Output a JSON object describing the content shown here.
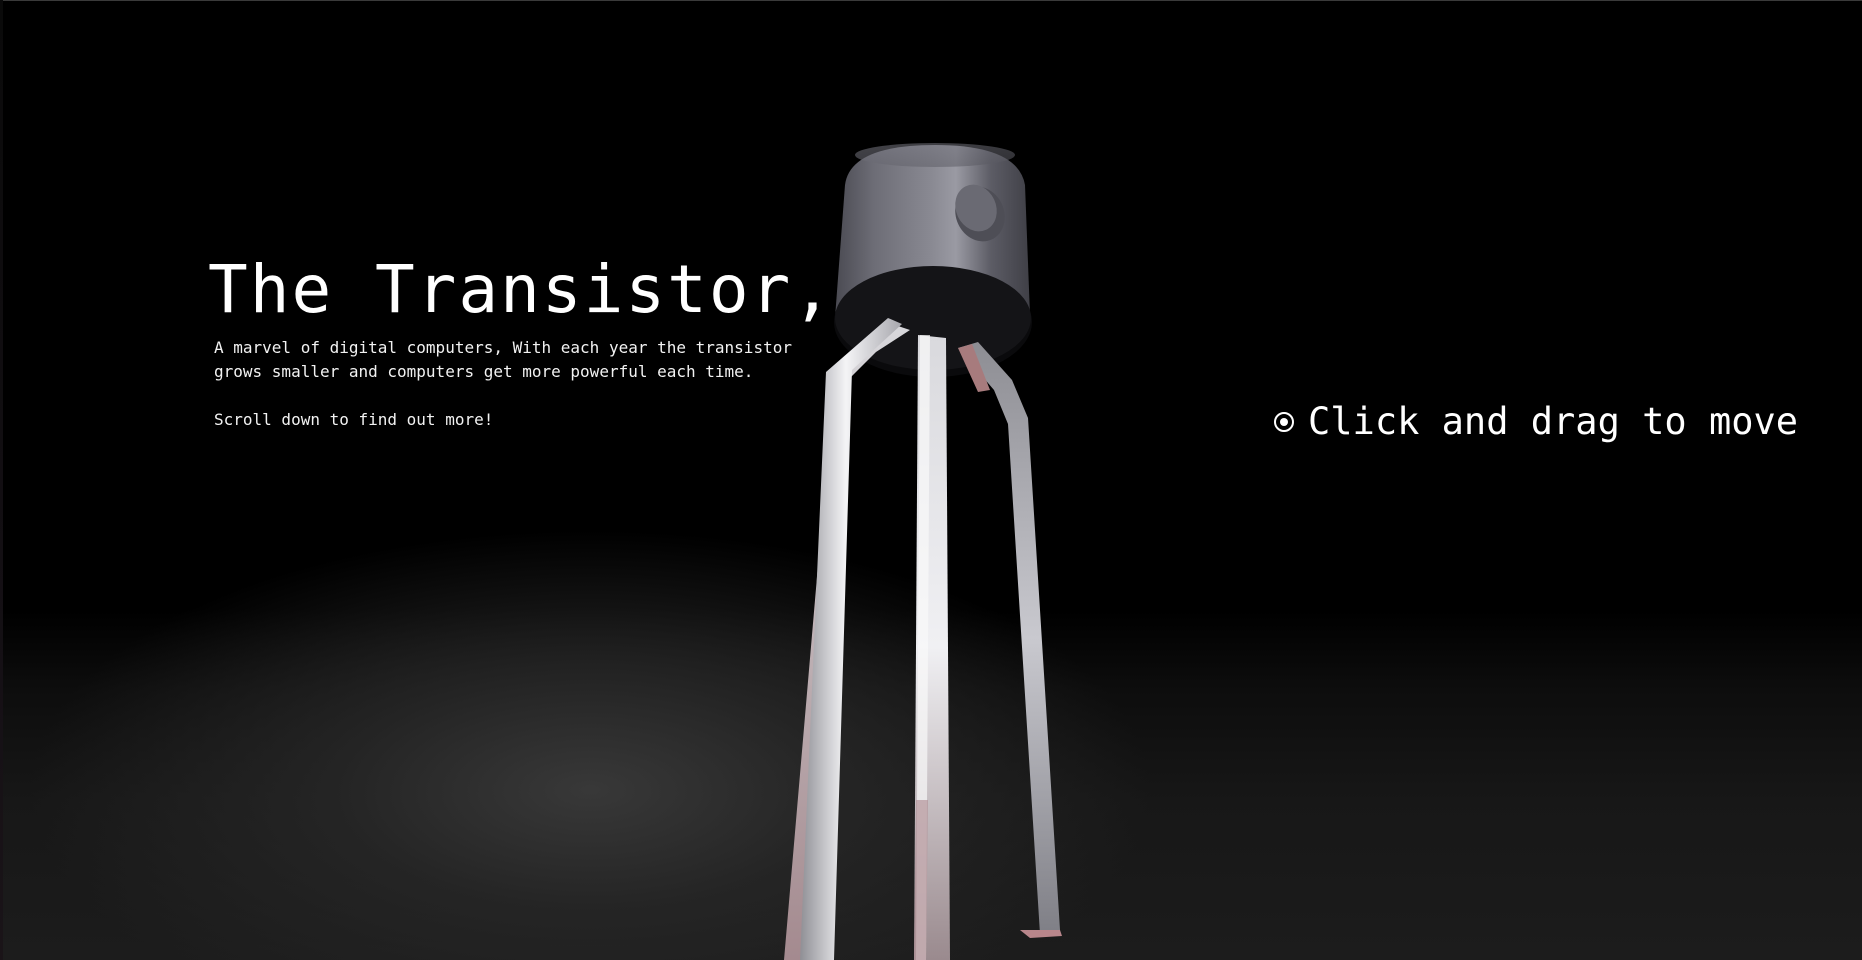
{
  "hero": {
    "title": "The Transistor,",
    "description": "A marvel of digital computers, With each year the transistor grows smaller and computers get more powerful each time.",
    "scroll_hint": "Scroll down to find out more!"
  },
  "interaction_hint": {
    "icon": "radio-dot-icon",
    "label": "Click and drag to move"
  },
  "scene": {
    "model": "transistor-icon",
    "colors": {
      "background": "#000000",
      "floor_glow": "#3a3a3a",
      "body": "#5f5f68",
      "leads": "#c8c8cc",
      "lead_tint": "#9c7a7a"
    }
  }
}
